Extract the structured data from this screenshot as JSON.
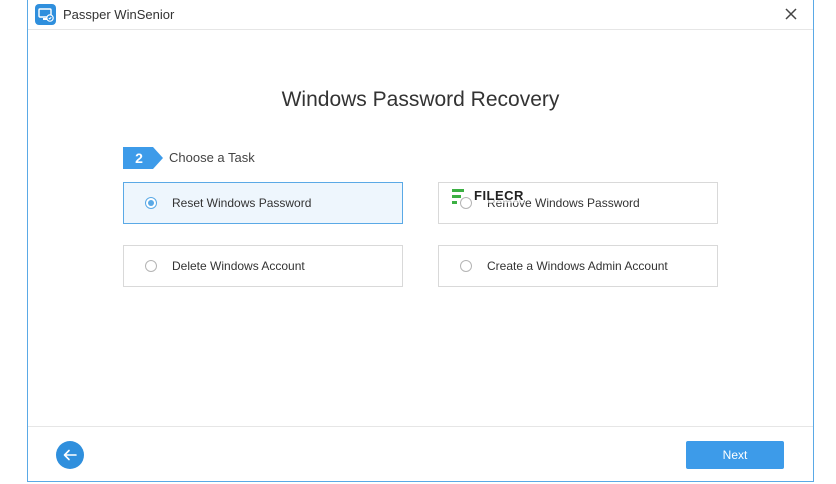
{
  "window": {
    "title": "Passper WinSenior",
    "app_icon": "monitor-lock-icon",
    "close_icon": "close-icon"
  },
  "main": {
    "heading": "Windows Password Recovery",
    "step": {
      "number": "2",
      "label": "Choose a Task"
    },
    "options": [
      {
        "label": "Reset Windows Password",
        "selected": true
      },
      {
        "label": "Remove Windows Password",
        "selected": false
      },
      {
        "label": "Delete Windows Account",
        "selected": false
      },
      {
        "label": "Create a Windows Admin Account",
        "selected": false
      }
    ]
  },
  "watermark": {
    "text": "FILECR"
  },
  "footer": {
    "back_icon": "arrow-left-icon",
    "next_label": "Next"
  },
  "colors": {
    "accent": "#3d9be9",
    "selected_bg": "#eef6fd",
    "selected_border": "#5aa9e6"
  }
}
